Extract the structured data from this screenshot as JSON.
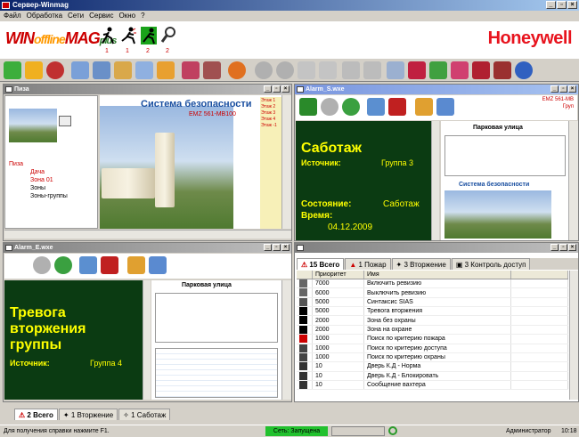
{
  "app": {
    "title": "Сервер-Winmag"
  },
  "menu": [
    "Файл",
    "Обработка",
    "Сети",
    "Сервис",
    "Окно",
    "?"
  ],
  "logo": {
    "w": "WIN",
    "offline": "offline",
    "mag": "MAG",
    "plus": "plus",
    "brand": "Honeywell"
  },
  "logo_icons": [
    {
      "name": "user-walk-icon",
      "num": "1"
    },
    {
      "name": "user-run-icon",
      "num": "1"
    },
    {
      "name": "user-alarm-icon",
      "num": "2"
    },
    {
      "name": "magnifier-icon",
      "num": "2"
    }
  ],
  "windows": {
    "pisa": {
      "title": "Пиза",
      "header": "Система безопасности",
      "device": "EMZ 561-MB100",
      "tree": [
        "Пиза",
        "Дача",
        "Зона 01",
        "Зоны",
        "Зоны-группы"
      ],
      "zones": [
        "Этаж 1",
        "Этаж 2",
        "Этаж 3",
        "Этаж 4",
        "Этаж -1"
      ]
    },
    "alarm_s": {
      "title": "Alarm_S.wxe",
      "device": "EMZ 561-MB",
      "group": "Груп",
      "headline": "Саботаж",
      "source_label": "Источник:",
      "source_value": "Группа 3",
      "state_label": "Состояние:",
      "state_value": "Саботаж",
      "time_label": "Время:",
      "time_value": "04.12.2009",
      "plan_title": "Парковая улица",
      "sub_title": "Система безопасности"
    },
    "alarm_e": {
      "title": "Alarm_E.wxe",
      "headline": "Тревога вторжения группы",
      "source_label": "Источник:",
      "source_value": "Группа 4",
      "plan_title": "Парковая улица"
    },
    "events": {
      "tabs": [
        "15 Всего",
        "1 Пожар",
        "3 Вторжение",
        "3 Контроль доступ"
      ],
      "columns": [
        "Приоритет",
        "Имя"
      ],
      "rows": [
        {
          "p": "7000",
          "n": "Включить ревизию"
        },
        {
          "p": "6000",
          "n": "Выключить ревизию"
        },
        {
          "p": "5000",
          "n": "Синтаксис SIAS"
        },
        {
          "p": "5000",
          "n": "Тревога вторжения"
        },
        {
          "p": "2000",
          "n": "Зона без охраны"
        },
        {
          "p": "2000",
          "n": "Зона на охране"
        },
        {
          "p": "1000",
          "n": "Поиск по критерию пожара"
        },
        {
          "p": "1000",
          "n": "Поиск по критерию доступа"
        },
        {
          "p": "1000",
          "n": "Поиск по критерию охраны"
        },
        {
          "p": "10",
          "n": "Дверь К.Д - Норма"
        },
        {
          "p": "10",
          "n": "Дверь К.Д - Блокировать"
        },
        {
          "p": "10",
          "n": "Сообщение вахтера"
        }
      ]
    }
  },
  "bottom_tabs": [
    "2 Всего",
    "1 Вторжение",
    "1 Саботаж"
  ],
  "status": {
    "help": "Для получения справки нажмите F1.",
    "net": "Сеть: Запущена",
    "user": "Администратор",
    "time": "10:18"
  },
  "colors": {
    "alarm_bg": "#0b3b12",
    "alarm_text": "#ffff00",
    "net_ok": "#22c12e",
    "brand": "#e8141e"
  }
}
